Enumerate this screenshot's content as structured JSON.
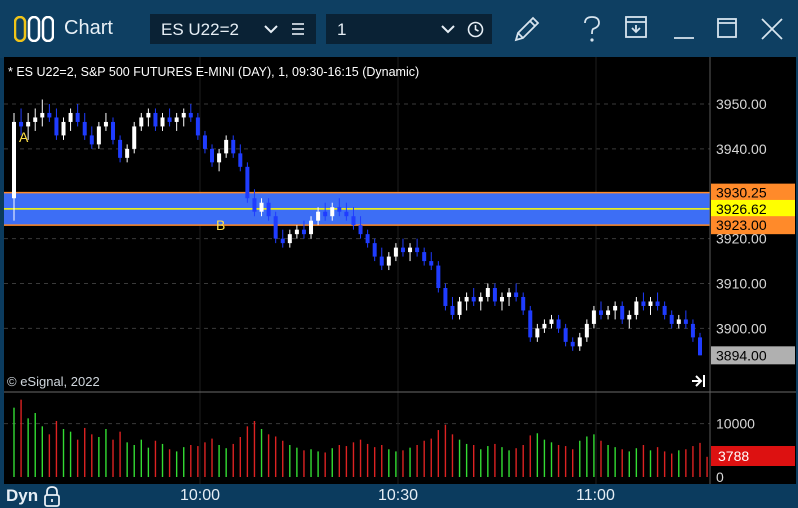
{
  "window": {
    "title": "Chart"
  },
  "toolbar": {
    "symbol_value": "ES U22=2",
    "interval_value": "1"
  },
  "chart_header": "* ES U22=2, S&P 500 FUTURES E-MINI (DAY), 1, 09:30-16:15 (Dynamic)",
  "copyright": "© eSignal, 2022",
  "markers": {
    "a": "A",
    "b": "B"
  },
  "colors": {
    "up": "#ffffff",
    "down": "#1f3cff",
    "band": "#3d6ef5",
    "band_line": "#ffff00",
    "band_edge": "#ff8a2a",
    "price_tag_bg": "#b0b0b0",
    "vol_tag_bg": "#dd1111",
    "vol_up": "#33dd33",
    "vol_down": "#dd2222",
    "marker": "#ffe14a"
  },
  "status_bar": {
    "mode": "Dyn",
    "time_labels": [
      "10:00",
      "10:30",
      "11:00"
    ]
  },
  "icons": [
    "logo-icon",
    "dropdown-chevron-icon",
    "menu-lines-icon",
    "clock-icon",
    "pencil-icon",
    "help-icon",
    "save-window-icon",
    "minimize-icon",
    "maximize-icon",
    "close-icon",
    "lock-icon",
    "jump-to-end-icon"
  ],
  "chart_data": {
    "type": "candlestick",
    "price_axis": {
      "range": [
        3891.4,
        3954.9
      ],
      "ticks": [
        "3950.00",
        "3940.00",
        "3930.00",
        "3920.00",
        "3910.00",
        "3900.00"
      ]
    },
    "band": {
      "top": "3930.25",
      "mid": "3926.62",
      "bottom": "3923.00"
    },
    "last_price": "3894.00",
    "volume_axis": {
      "ticks": [
        "10000",
        "0"
      ],
      "max": 15000
    },
    "last_volume": "3788",
    "candles": [
      [
        3929,
        3948,
        3924,
        3946
      ],
      [
        3946,
        3949,
        3943,
        3945
      ],
      [
        3945,
        3948,
        3942,
        3946
      ],
      [
        3946,
        3949,
        3944,
        3947
      ],
      [
        3947,
        3951,
        3945,
        3948
      ],
      [
        3948,
        3950,
        3946,
        3947
      ],
      [
        3947,
        3949,
        3942,
        3943
      ],
      [
        3943,
        3947,
        3942,
        3946
      ],
      [
        3946,
        3949,
        3944,
        3948
      ],
      [
        3948,
        3950,
        3945,
        3946
      ],
      [
        3946,
        3948,
        3942,
        3943
      ],
      [
        3943,
        3945,
        3940,
        3941
      ],
      [
        3941,
        3946,
        3940,
        3945
      ],
      [
        3945,
        3948,
        3944,
        3946
      ],
      [
        3946,
        3947,
        3941,
        3942
      ],
      [
        3942,
        3943,
        3937,
        3938
      ],
      [
        3938,
        3941,
        3937,
        3940
      ],
      [
        3940,
        3946,
        3939,
        3945
      ],
      [
        3945,
        3948,
        3944,
        3947
      ],
      [
        3947,
        3949,
        3945,
        3948
      ],
      [
        3948,
        3949,
        3944,
        3945
      ],
      [
        3945,
        3948,
        3944,
        3947
      ],
      [
        3947,
        3949,
        3945,
        3946
      ],
      [
        3946,
        3948,
        3944,
        3947
      ],
      [
        3947,
        3949,
        3945,
        3948
      ],
      [
        3948,
        3950,
        3946,
        3947
      ],
      [
        3947,
        3948,
        3942,
        3943
      ],
      [
        3943,
        3944,
        3939,
        3940
      ],
      [
        3940,
        3941,
        3936,
        3937
      ],
      [
        3937,
        3940,
        3935,
        3939
      ],
      [
        3939,
        3943,
        3938,
        3942
      ],
      [
        3942,
        3943,
        3938,
        3939
      ],
      [
        3939,
        3941,
        3935,
        3936
      ],
      [
        3936,
        3937,
        3928,
        3929
      ],
      [
        3929,
        3931,
        3925,
        3926
      ],
      [
        3926,
        3929,
        3925,
        3928
      ],
      [
        3928,
        3929,
        3924,
        3925
      ],
      [
        3925,
        3926,
        3919,
        3920
      ],
      [
        3920,
        3922,
        3918,
        3919
      ],
      [
        3919,
        3922,
        3918,
        3921
      ],
      [
        3921,
        3923,
        3920,
        3922
      ],
      [
        3922,
        3924,
        3920,
        3921
      ],
      [
        3921,
        3925,
        3920,
        3924
      ],
      [
        3924,
        3927,
        3923,
        3926
      ],
      [
        3926,
        3928,
        3924,
        3925
      ],
      [
        3925,
        3928,
        3924,
        3927
      ],
      [
        3927,
        3929,
        3925,
        3926
      ],
      [
        3926,
        3928,
        3924,
        3925
      ],
      [
        3925,
        3927,
        3922,
        3923
      ],
      [
        3923,
        3925,
        3920,
        3921
      ],
      [
        3921,
        3922,
        3918,
        3919
      ],
      [
        3919,
        3920,
        3915,
        3916
      ],
      [
        3916,
        3918,
        3913,
        3914
      ],
      [
        3914,
        3917,
        3913,
        3916
      ],
      [
        3916,
        3919,
        3915,
        3918
      ],
      [
        3918,
        3920,
        3916,
        3917
      ],
      [
        3917,
        3919,
        3915,
        3918
      ],
      [
        3918,
        3920,
        3916,
        3917
      ],
      [
        3917,
        3918,
        3914,
        3915
      ],
      [
        3915,
        3917,
        3913,
        3914
      ],
      [
        3914,
        3915,
        3908,
        3909
      ],
      [
        3909,
        3910,
        3904,
        3905
      ],
      [
        3905,
        3907,
        3902,
        3903
      ],
      [
        3903,
        3907,
        3902,
        3906
      ],
      [
        3906,
        3908,
        3904,
        3907
      ],
      [
        3907,
        3909,
        3905,
        3906
      ],
      [
        3906,
        3908,
        3904,
        3907
      ],
      [
        3907,
        3910,
        3906,
        3909
      ],
      [
        3909,
        3910,
        3905,
        3906
      ],
      [
        3906,
        3908,
        3904,
        3907
      ],
      [
        3907,
        3909,
        3905,
        3908
      ],
      [
        3908,
        3910,
        3906,
        3907
      ],
      [
        3907,
        3908,
        3903,
        3904
      ],
      [
        3904,
        3905,
        3897,
        3898
      ],
      [
        3898,
        3901,
        3897,
        3900
      ],
      [
        3900,
        3902,
        3899,
        3901
      ],
      [
        3901,
        3903,
        3900,
        3902
      ],
      [
        3902,
        3903,
        3899,
        3900
      ],
      [
        3900,
        3901,
        3896,
        3897
      ],
      [
        3897,
        3898,
        3895,
        3896
      ],
      [
        3896,
        3899,
        3895,
        3898
      ],
      [
        3898,
        3902,
        3897,
        3901
      ],
      [
        3901,
        3905,
        3900,
        3904
      ],
      [
        3904,
        3906,
        3902,
        3903
      ],
      [
        3903,
        3905,
        3902,
        3904
      ],
      [
        3904,
        3906,
        3902,
        3905
      ],
      [
        3905,
        3906,
        3901,
        3902
      ],
      [
        3902,
        3904,
        3900,
        3903
      ],
      [
        3903,
        3907,
        3902,
        3906
      ],
      [
        3906,
        3908,
        3904,
        3905
      ],
      [
        3905,
        3907,
        3903,
        3906
      ],
      [
        3906,
        3908,
        3904,
        3905
      ],
      [
        3905,
        3906,
        3902,
        3903
      ],
      [
        3903,
        3904,
        3900,
        3901
      ],
      [
        3901,
        3903,
        3900,
        3902
      ],
      [
        3902,
        3904,
        3900,
        3901
      ],
      [
        3901,
        3902,
        3897,
        3898
      ],
      [
        3898,
        3899,
        3894,
        3894
      ]
    ],
    "volumes": [
      13000,
      14500,
      11000,
      12000,
      9500,
      8000,
      10500,
      9000,
      8500,
      7000,
      9200,
      8000,
      7500,
      9000,
      7000,
      8500,
      6500,
      6000,
      7000,
      5500,
      6800,
      6200,
      5200,
      4800,
      5600,
      6000,
      5800,
      6500,
      7200,
      6000,
      5400,
      6200,
      7500,
      9500,
      10500,
      9000,
      8000,
      7600,
      6800,
      6000,
      5500,
      5000,
      5200,
      4800,
      4600,
      5400,
      6000,
      5800,
      6500,
      7000,
      6200,
      5600,
      6000,
      5200,
      4800,
      5000,
      5500,
      6000,
      6800,
      7200,
      8800,
      9800,
      8000,
      7000,
      6200,
      6000,
      5200,
      5800,
      6200,
      5600,
      5000,
      5400,
      6000,
      7800,
      8200,
      7000,
      6500,
      6000,
      5800,
      5200,
      6800,
      7600,
      8000,
      6800,
      6000,
      5600,
      5200,
      4800,
      5400,
      6000,
      5000,
      5600,
      4800,
      4400,
      5000,
      5200,
      5800,
      6400,
      3788
    ],
    "time_ticks": [
      "10:00",
      "10:30",
      "11:00"
    ]
  }
}
